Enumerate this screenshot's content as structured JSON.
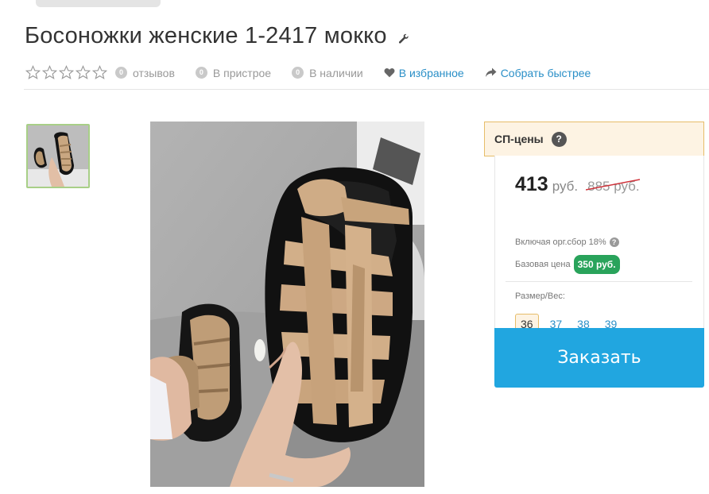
{
  "product": {
    "title": "Босоножки женские 1-2417 мокко"
  },
  "meta": {
    "reviews_count": "0",
    "reviews_label": "отзывов",
    "attach_count": "0",
    "attach_label": "В пристрое",
    "stock_count": "0",
    "stock_label": "В наличии",
    "favorite_label": "В избранное",
    "collect_label": "Собрать быстрее"
  },
  "price_card": {
    "header": "СП-цены",
    "help_icon": "?",
    "price": "413",
    "currency": "руб.",
    "old_price": "885 руб.",
    "incl_fee": "Включая орг.сбор 18%",
    "incl_help": "?",
    "base_label": "Базовая цена",
    "base_price": "350 руб.",
    "size_label": "Размер/Вес:",
    "sizes": [
      "36",
      "37",
      "38",
      "39"
    ],
    "order_button": "Заказать"
  },
  "colors": {
    "accent_blue": "#21a6e0",
    "link_blue": "#2a8fc7",
    "base_green": "#29a35b",
    "header_border": "#e6bd69",
    "thumb_border": "#a8cf87"
  },
  "icons": {
    "edit": "wrench-icon",
    "favorite": "heart-icon",
    "share": "share-arrow-icon",
    "rating": "star-outline-icon"
  }
}
